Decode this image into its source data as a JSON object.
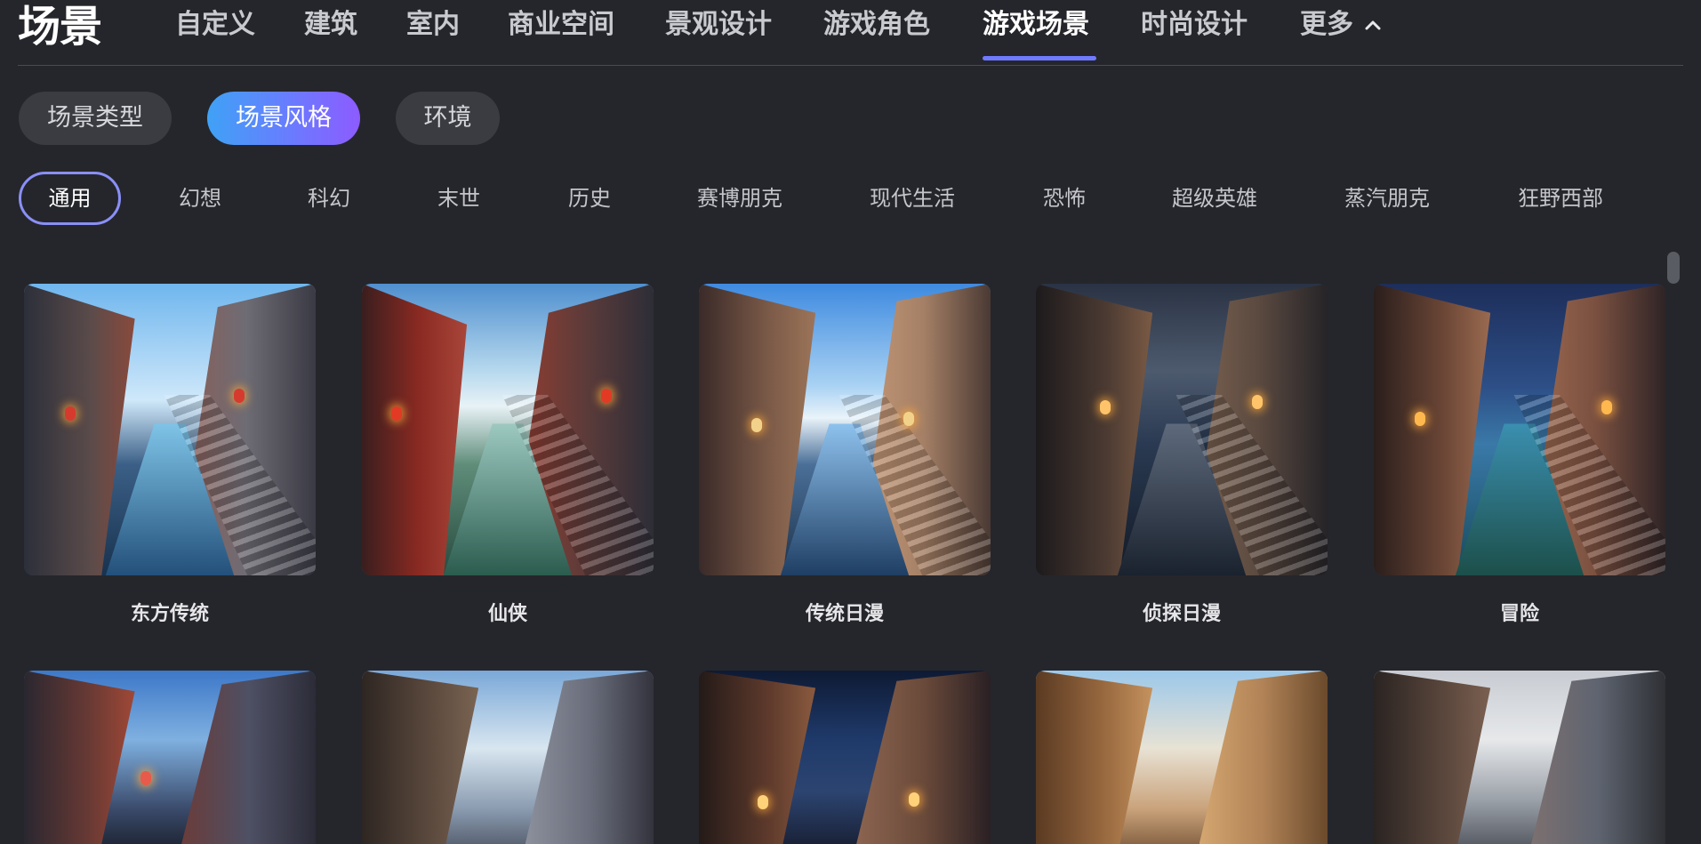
{
  "header": {
    "title": "场景",
    "tabs": [
      {
        "label": "自定义",
        "active": false
      },
      {
        "label": "建筑",
        "active": false
      },
      {
        "label": "室内",
        "active": false
      },
      {
        "label": "商业空间",
        "active": false
      },
      {
        "label": "景观设计",
        "active": false
      },
      {
        "label": "游戏角色",
        "active": false
      },
      {
        "label": "游戏场景",
        "active": true
      },
      {
        "label": "时尚设计",
        "active": false
      },
      {
        "label": "更多",
        "active": false
      }
    ]
  },
  "categories": [
    {
      "label": "场景类型",
      "active": false
    },
    {
      "label": "场景风格",
      "active": true
    },
    {
      "label": "环境",
      "active": false
    }
  ],
  "style_filters": [
    {
      "label": "通用",
      "active": true
    },
    {
      "label": "幻想",
      "active": false
    },
    {
      "label": "科幻",
      "active": false
    },
    {
      "label": "末世",
      "active": false
    },
    {
      "label": "历史",
      "active": false
    },
    {
      "label": "赛博朋克",
      "active": false
    },
    {
      "label": "现代生活",
      "active": false
    },
    {
      "label": "恐怖",
      "active": false
    },
    {
      "label": "超级英雄",
      "active": false
    },
    {
      "label": "蒸汽朋克",
      "active": false
    },
    {
      "label": "狂野西部",
      "active": false
    }
  ],
  "styles": [
    {
      "label": "东方传统"
    },
    {
      "label": "仙侠"
    },
    {
      "label": "传统日漫"
    },
    {
      "label": "侦探日漫"
    },
    {
      "label": "冒险"
    }
  ],
  "colors": {
    "accent": "#6f7bff",
    "pill_gradient_start": "#3fa2f6",
    "pill_gradient_end": "#8d5bff",
    "background": "#25262b"
  }
}
